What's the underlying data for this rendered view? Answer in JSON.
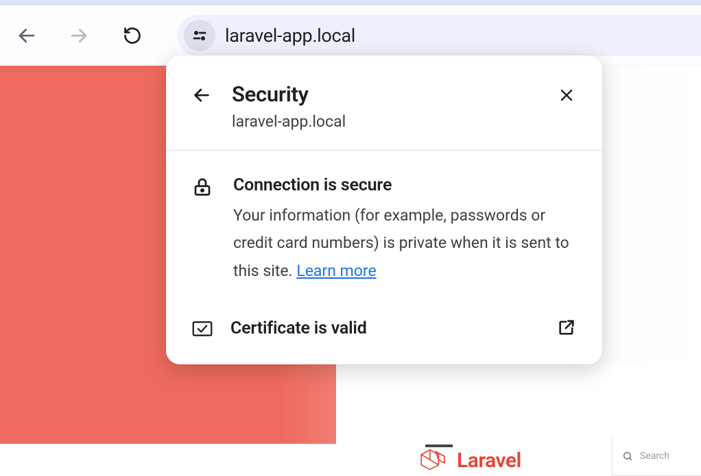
{
  "address_bar": {
    "url": "laravel-app.local"
  },
  "popover": {
    "title": "Security",
    "subtitle": "laravel-app.local",
    "connection": {
      "title": "Connection is secure",
      "description": "Your information (for example, passwords or credit card numbers) is private when it is sent to this site. ",
      "learn_more": "Learn more"
    },
    "certificate": {
      "label": "Certificate is valid"
    }
  },
  "page": {
    "logo_text": "Laravel",
    "search_placeholder": "Search"
  },
  "colors": {
    "accent_red": "#ef6a5e",
    "link_blue": "#1a73e8",
    "laravel_red": "#e74430"
  }
}
